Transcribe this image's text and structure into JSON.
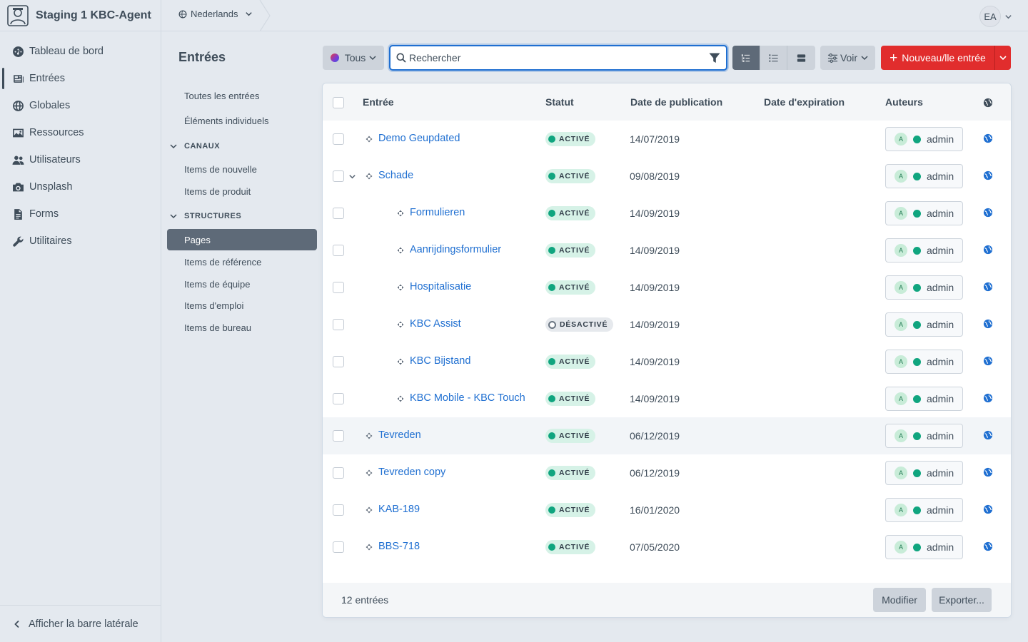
{
  "site": {
    "name": "Staging 1 KBC-Agent"
  },
  "nav": [
    {
      "label": "Tableau de bord",
      "icon": "gauge-icon"
    },
    {
      "label": "Entrées",
      "icon": "newspaper-icon"
    },
    {
      "label": "Globales",
      "icon": "globe-icon"
    },
    {
      "label": "Ressources",
      "icon": "image-icon"
    },
    {
      "label": "Utilisateurs",
      "icon": "users-icon"
    },
    {
      "label": "Unsplash",
      "icon": "camera-icon"
    },
    {
      "label": "Forms",
      "icon": "file-icon"
    },
    {
      "label": "Utilitaires",
      "icon": "wrench-icon"
    }
  ],
  "sidebar_toggle_label": "Afficher la barre latérale",
  "topbar": {
    "site_switcher": "Nederlands",
    "user_initials": "EA"
  },
  "entries_title": "Entrées",
  "sources": {
    "all": "Toutes les entrées",
    "singles": "Éléments individuels",
    "channels_heading": "CANAUX",
    "channels": [
      "Items de nouvelle",
      "Items de produit"
    ],
    "structures_heading": "STRUCTURES",
    "structures": [
      "Pages",
      "Items de référence",
      "Items de équipe",
      "Items d'emploi",
      "Items de bureau"
    ]
  },
  "toolbar": {
    "site_menu": "Tous",
    "search_placeholder": "Rechercher",
    "view_button": "Voir",
    "new_entry": "Nouveau/lle entrée"
  },
  "columns": {
    "title": "Entrée",
    "status": "Statut",
    "post_date": "Date de publication",
    "expiry_date": "Date d'expiration",
    "authors": "Auteurs"
  },
  "rows": [
    {
      "title": "Demo Geupdated",
      "status": "ACTIVÉ",
      "post_date": "14/07/2019",
      "level": 1,
      "author": "admin",
      "author_initial": "A"
    },
    {
      "title": "Schade",
      "status": "ACTIVÉ",
      "post_date": "09/08/2019",
      "level": 1,
      "author": "admin",
      "author_initial": "A",
      "expanded": true
    },
    {
      "title": "Formulieren",
      "status": "ACTIVÉ",
      "post_date": "14/09/2019",
      "level": 2,
      "author": "admin",
      "author_initial": "A"
    },
    {
      "title": "Aanrijdingsformulier",
      "status": "ACTIVÉ",
      "post_date": "14/09/2019",
      "level": 2,
      "author": "admin",
      "author_initial": "A"
    },
    {
      "title": "Hospitalisatie",
      "status": "ACTIVÉ",
      "post_date": "14/09/2019",
      "level": 2,
      "author": "admin",
      "author_initial": "A"
    },
    {
      "title": "KBC Assist",
      "status": "DÉSACTIVÉ",
      "post_date": "14/09/2019",
      "level": 2,
      "author": "admin",
      "author_initial": "A",
      "disabled": true
    },
    {
      "title": "KBC Bijstand",
      "status": "ACTIVÉ",
      "post_date": "14/09/2019",
      "level": 2,
      "author": "admin",
      "author_initial": "A"
    },
    {
      "title": "KBC Mobile - KBC Touch",
      "status": "ACTIVÉ",
      "post_date": "14/09/2019",
      "level": 2,
      "author": "admin",
      "author_initial": "A"
    },
    {
      "title": "Tevreden",
      "status": "ACTIVÉ",
      "post_date": "06/12/2019",
      "level": 1,
      "author": "admin",
      "author_initial": "A",
      "highlight": true
    },
    {
      "title": "Tevreden copy",
      "status": "ACTIVÉ",
      "post_date": "06/12/2019",
      "level": 1,
      "author": "admin",
      "author_initial": "A"
    },
    {
      "title": "KAB-189",
      "status": "ACTIVÉ",
      "post_date": "16/01/2020",
      "level": 1,
      "author": "admin",
      "author_initial": "A"
    },
    {
      "title": "BBS-718",
      "status": "ACTIVÉ",
      "post_date": "07/05/2020",
      "level": 1,
      "author": "admin",
      "author_initial": "A"
    }
  ],
  "footer": {
    "count": "12 entrées",
    "edit": "Modifier",
    "export": "Exporter..."
  },
  "colors": {
    "accent": "#1f6fd1",
    "primary_button": "#e12d2d",
    "status_enabled": "#10a57f"
  }
}
